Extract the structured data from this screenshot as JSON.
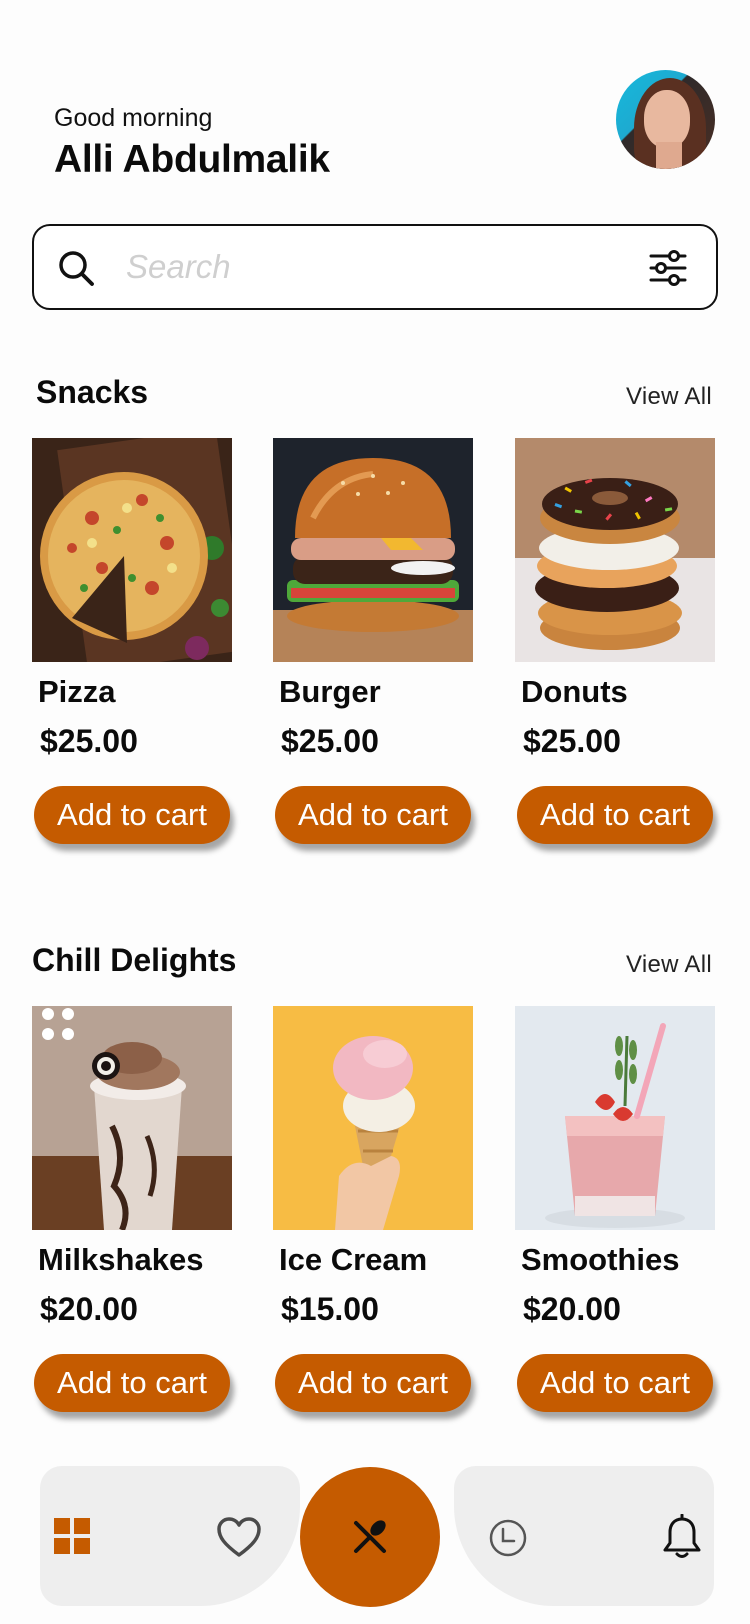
{
  "header": {
    "greeting": "Good morning",
    "username": "Alli Abdulmalik"
  },
  "search": {
    "placeholder": "Search",
    "value": ""
  },
  "sections": [
    {
      "title": "Snacks",
      "view_all": "View All",
      "items": [
        {
          "name": "Pizza",
          "price": "$25.00",
          "button": "Add to cart",
          "image": "pizza"
        },
        {
          "name": "Burger",
          "price": "$25.00",
          "button": "Add to cart",
          "image": "burger"
        },
        {
          "name": "Donuts",
          "price": "$25.00",
          "button": "Add to cart",
          "image": "donuts"
        }
      ]
    },
    {
      "title": "Chill Delights",
      "view_all": "View All",
      "items": [
        {
          "name": "Milkshakes",
          "price": "$20.00",
          "button": "Add to cart",
          "image": "milkshake"
        },
        {
          "name": "Ice Cream",
          "price": "$15.00",
          "button": "Add to cart",
          "image": "ice-cream"
        },
        {
          "name": "Smoothies",
          "price": "$20.00",
          "button": "Add to cart",
          "image": "smoothie"
        }
      ]
    }
  ],
  "tabbar": {
    "items": [
      "grid-icon",
      "heart-icon",
      "fork-spoon-icon",
      "clock-icon",
      "bell-icon"
    ],
    "active": "fork-spoon-icon"
  },
  "colors": {
    "accent": "#c55b00",
    "tabbar_bg": "#eeeeee",
    "text": "#0b0b0b"
  }
}
